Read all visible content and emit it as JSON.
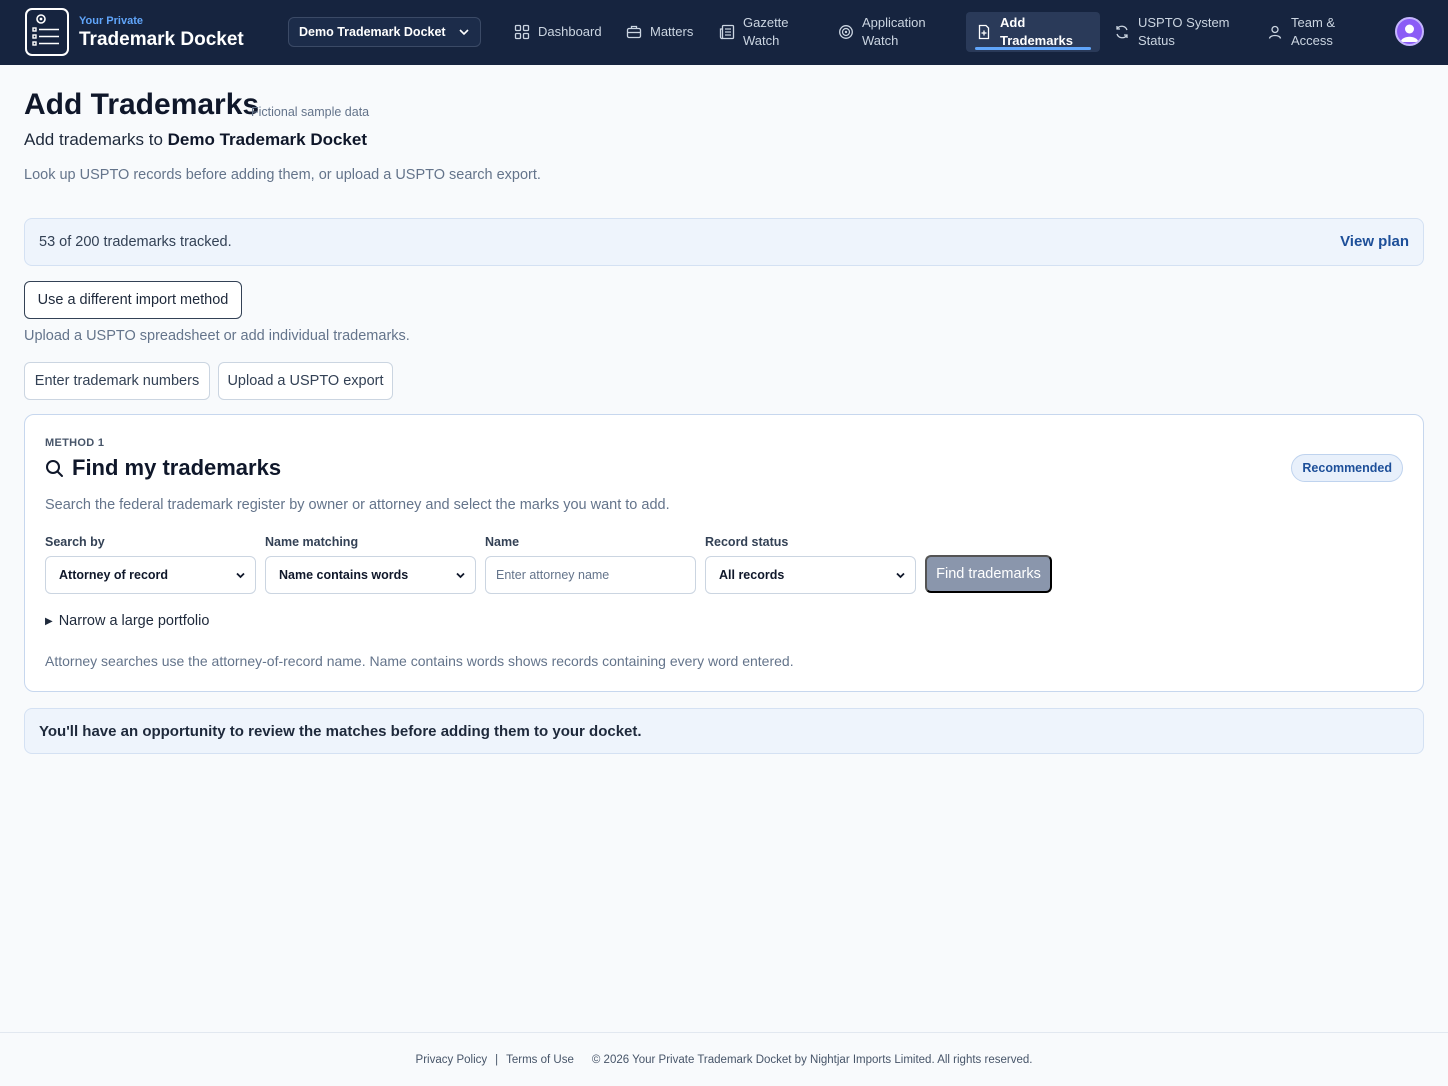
{
  "brand": {
    "small": "Your Private",
    "big": "Trademark Docket"
  },
  "docket_select": {
    "value": "Demo Trademark Docket"
  },
  "nav": {
    "dashboard": "Dashboard",
    "matters": "Matters",
    "gazette_1": "Gazette",
    "gazette_2": "Watch",
    "application_1": "Application",
    "application_2": "Watch",
    "add_1": "Add",
    "add_2": "Trademarks",
    "uspto_1": "USPTO System",
    "uspto_2": "Status",
    "team_1": "Team &",
    "team_2": "Access"
  },
  "page": {
    "title": "Add Trademarks",
    "sample_tag": "Fictional sample data",
    "subtitle_prefix": "Add trademarks to",
    "subtitle_docket": "Demo Trademark Docket",
    "intro": "Look up USPTO records before adding them, or upload a USPTO search export."
  },
  "usage": {
    "text": "53 of 200 trademarks tracked.",
    "tracked": 53,
    "limit": 200,
    "view_plan": "View plan"
  },
  "import": {
    "different_method": "Use a different import method",
    "hint": "Upload a USPTO spreadsheet or add individual trademarks.",
    "enter_numbers": "Enter trademark numbers",
    "upload_export": "Upload a USPTO export"
  },
  "method_card": {
    "tag": "METHOD 1",
    "title": "Find my trademarks",
    "badge": "Recommended",
    "description": "Search the federal trademark register by owner or attorney and select the marks you want to add.",
    "search_by_label": "Search by",
    "search_by_value": "Attorney of record",
    "name_matching_label": "Name matching",
    "name_matching_value": "Name contains words",
    "name_label": "Name",
    "name_placeholder": "Enter attorney name",
    "record_status_label": "Record status",
    "record_status_value": "All records",
    "find_button": "Find trademarks",
    "narrow": "Narrow a large portfolio",
    "help": "Attorney searches use the attorney-of-record name. Name contains words shows records containing every word entered."
  },
  "review": {
    "text": "You'll have an opportunity to review the matches before adding them to your docket."
  },
  "footer": {
    "privacy": "Privacy Policy",
    "separator": "|",
    "terms": "Terms of Use",
    "copyright": "© 2026 Your Private Trademark Docket by Nightjar Imports Limited. All rights reserved."
  },
  "colors": {
    "nav_background": "#16243f",
    "accent": "#1d4f99",
    "active_underline": "#60a5fa",
    "avatar": "#8b5cf6"
  },
  "icons": {
    "brand": "docket-list-icon",
    "dashboard": "grid-icon",
    "matters": "briefcase-icon",
    "gazette": "newspaper-icon",
    "application": "radar-icon",
    "add": "document-plus-icon",
    "uspto": "refresh-icon",
    "team": "user-icon",
    "search": "search-icon"
  }
}
